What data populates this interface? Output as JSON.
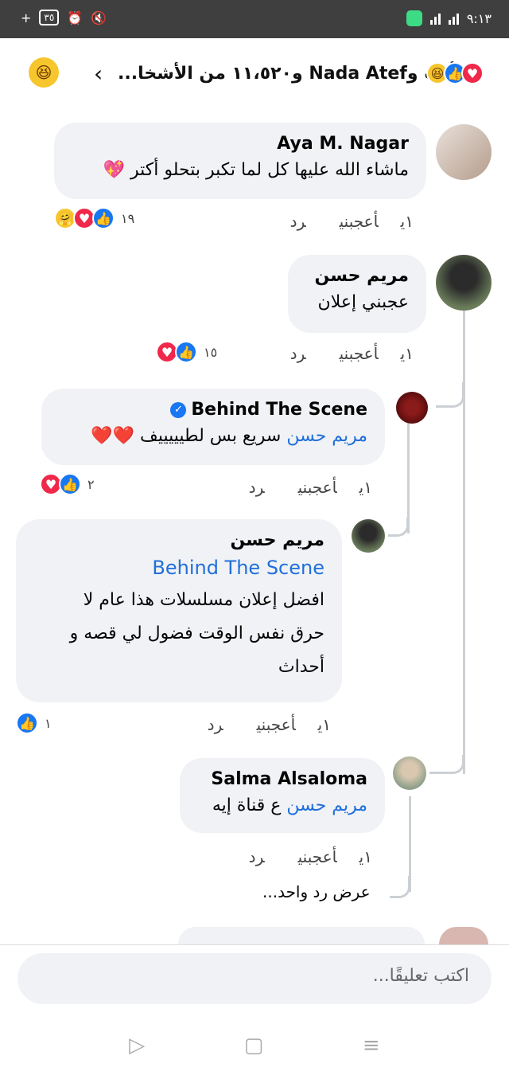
{
  "status_bar": {
    "time": "٩:١٣",
    "battery": "٣٥",
    "network": "4G"
  },
  "header": {
    "title": "أنت وNada Atef و١١،٥٢٠ من الأشخا...",
    "back_icon": "chevron-left-icon"
  },
  "comments": [
    {
      "author": "Aya M. Nagar",
      "text": "ماشاء الله عليها كل لما تكبر بتحلو أكتر 💖",
      "time": "١ي",
      "like": "أعجبني",
      "reply": "رد",
      "reactions_count": "١٩"
    },
    {
      "author": "مريم حسن",
      "text": "عجبني إعلان",
      "time": "١ي",
      "like": "أعجبني",
      "reply": "رد",
      "reactions_count": "١٥"
    },
    {
      "author": "Behind The Scene",
      "mention": "مريم حسن",
      "text": " سريع بس لطيييييف ❤️❤️",
      "time": "١ي",
      "like": "أعجبني",
      "reply": "رد",
      "reactions_count": "٢"
    },
    {
      "author": "مريم حسن",
      "mention": "Behind The Scene",
      "text": "افضل إعلان مسلسلات هذا عام لا حرق نفس الوقت فضول لي قصه و أحداث",
      "time": "١ي",
      "like": "أعجبني",
      "reply": "رد",
      "reactions_count": "١"
    },
    {
      "author": "Salma Alsaloma",
      "mention": "مريم حسن",
      "text": " ع قناة إيه",
      "time": "١ي",
      "like": "أعجبني",
      "reply": "رد"
    }
  ],
  "view_more": "عرض رد واحد...",
  "composer": {
    "placeholder": "اكتب تعليقًا..."
  }
}
